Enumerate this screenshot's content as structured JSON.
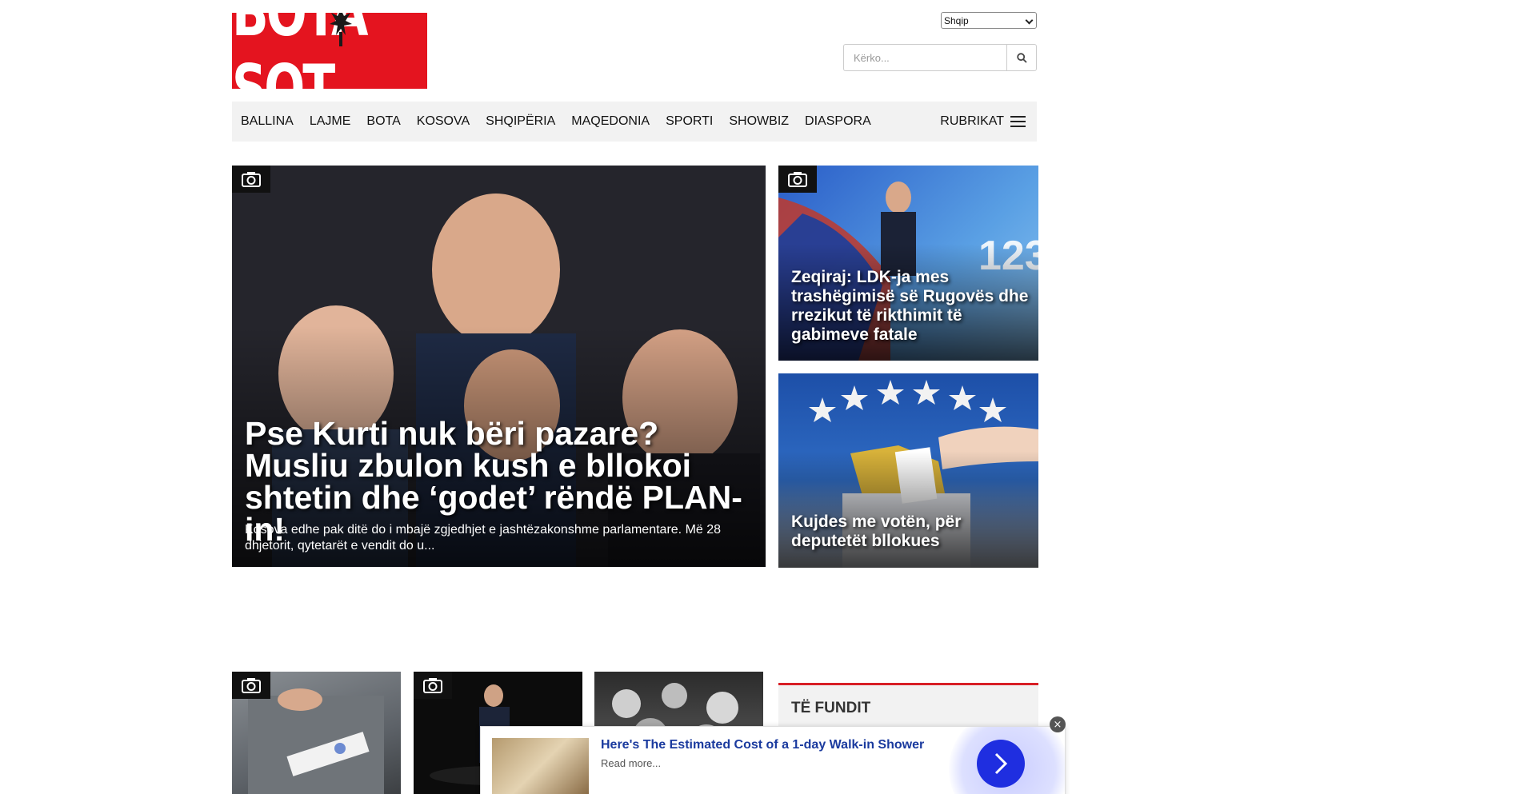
{
  "header": {
    "logo_text": "BOTA SOT",
    "language": "Shqip",
    "search_placeholder": "Kërko..."
  },
  "nav": {
    "items": [
      "BALLINA",
      "LAJME",
      "BOTA",
      "KOSOVA",
      "SHQIPËRIA",
      "MAQEDONIA",
      "SPORTI",
      "SHOWBIZ",
      "DIASPORA"
    ],
    "rubrikat": "RUBRIKAT"
  },
  "hero": {
    "title": "Pse Kurti nuk bëri pazare? Musliu zbulon kush e bllokoi shtetin dhe ‘godet’ rëndë PLAN-in!",
    "excerpt": "Kosova edhe pak ditë do i mbajë zgjedhjet e jashtëzakonshme parlamentare. Më 28 dhjetorit, qytetarët e vendit do u..."
  },
  "side_articles": [
    {
      "title": "Zeqiraj: LDK-ja mes trashëgimisë së Rugovës dhe rrezikut të rikthimit të gabimeve fatale"
    },
    {
      "title": "Kujdes me votën, për deputetët bllokues"
    }
  ],
  "sidebar": {
    "te_fundit": "TË FUNDIT"
  },
  "ad": {
    "title": "Here's The Estimated Cost of a 1-day Walk-in Shower",
    "more": "Read more...",
    "close": "×"
  },
  "colors": {
    "brand_red": "#e4141f",
    "accent_red": "#d81f26",
    "nav_bg": "#f2f2f2",
    "ad_blue": "#1f2ee0"
  }
}
